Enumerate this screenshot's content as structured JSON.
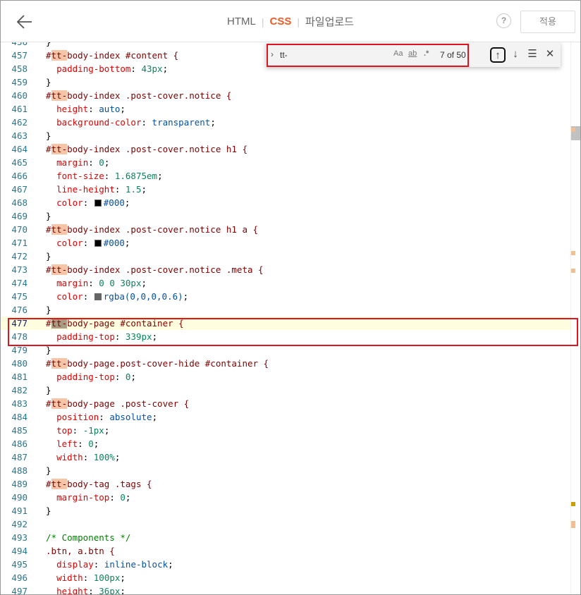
{
  "header": {
    "tabs": [
      {
        "label": "HTML",
        "active": false
      },
      {
        "label": "CSS",
        "active": true
      },
      {
        "label": "파일업로드",
        "active": false
      }
    ],
    "help_label": "?",
    "apply_label": "적용"
  },
  "find": {
    "query": "tt-",
    "match_case": "Aa",
    "whole_word": "ab",
    "regex": ".*",
    "count": "7 of 50"
  },
  "colors": {
    "accent": "#f15a24",
    "annotation": "#e0141e",
    "selector": "#800000",
    "property": "#e50000",
    "value": "#0451a5",
    "number": "#098658",
    "comment": "#008000"
  },
  "lines": [
    {
      "n": "456",
      "t": "}"
    },
    {
      "n": "457",
      "t": "#tt-body-index #content {"
    },
    {
      "n": "458",
      "t": "  padding-bottom: 43px;"
    },
    {
      "n": "459",
      "t": "}"
    },
    {
      "n": "460",
      "t": "#tt-body-index .post-cover.notice {"
    },
    {
      "n": "461",
      "t": "  height: auto;"
    },
    {
      "n": "462",
      "t": "  background-color: transparent;"
    },
    {
      "n": "463",
      "t": "}"
    },
    {
      "n": "464",
      "t": "#tt-body-index .post-cover.notice h1 {"
    },
    {
      "n": "465",
      "t": "  margin: 0;"
    },
    {
      "n": "466",
      "t": "  font-size: 1.6875em;"
    },
    {
      "n": "467",
      "t": "  line-height: 1.5;"
    },
    {
      "n": "468",
      "t": "  color: #000;"
    },
    {
      "n": "469",
      "t": "}"
    },
    {
      "n": "470",
      "t": "#tt-body-index .post-cover.notice h1 a {"
    },
    {
      "n": "471",
      "t": "  color: #000;"
    },
    {
      "n": "472",
      "t": "}"
    },
    {
      "n": "473",
      "t": "#tt-body-index .post-cover.notice .meta {"
    },
    {
      "n": "474",
      "t": "  margin: 0 0 30px;"
    },
    {
      "n": "475",
      "t": "  color: rgba(0,0,0,0.6);"
    },
    {
      "n": "476",
      "t": "}"
    },
    {
      "n": "477",
      "t": "#tt-body-page #container {"
    },
    {
      "n": "478",
      "t": "  padding-top: 339px;"
    },
    {
      "n": "479",
      "t": "}"
    },
    {
      "n": "480",
      "t": "#tt-body-page.post-cover-hide #container {"
    },
    {
      "n": "481",
      "t": "  padding-top: 0;"
    },
    {
      "n": "482",
      "t": "}"
    },
    {
      "n": "483",
      "t": "#tt-body-page .post-cover {"
    },
    {
      "n": "484",
      "t": "  position: absolute;"
    },
    {
      "n": "485",
      "t": "  top: -1px;"
    },
    {
      "n": "486",
      "t": "  left: 0;"
    },
    {
      "n": "487",
      "t": "  width: 100%;"
    },
    {
      "n": "488",
      "t": "}"
    },
    {
      "n": "489",
      "t": "#tt-body-tag .tags {"
    },
    {
      "n": "490",
      "t": "  margin-top: 0;"
    },
    {
      "n": "491",
      "t": "}"
    },
    {
      "n": "492",
      "t": ""
    },
    {
      "n": "493",
      "t": "/* Components */"
    },
    {
      "n": "494",
      "t": ".btn, a.btn {"
    },
    {
      "n": "495",
      "t": "  display: inline-block;"
    },
    {
      "n": "496",
      "t": "  width: 100px;"
    },
    {
      "n": "497",
      "t": "  height: 36px;"
    }
  ],
  "current_line": "477"
}
